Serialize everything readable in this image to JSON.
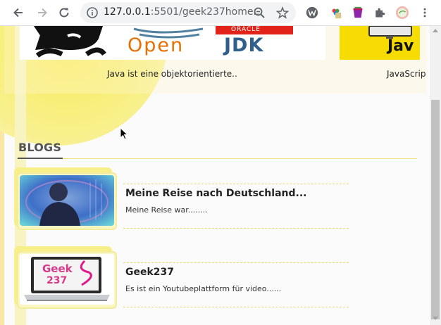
{
  "browser": {
    "url_host": "127.0.0.1",
    "url_rest": ":5501/geek237home...",
    "icons": {
      "back": "arrow-left-icon",
      "forward": "arrow-right-icon",
      "reload": "reload-icon",
      "site_info": "info-icon",
      "zoom": "zoom-icon",
      "bookmark": "star-icon",
      "extensions": "puzzle-icon",
      "menu": "kebab-menu-icon"
    }
  },
  "cards": [
    {
      "caption": "Java ist eine objektorientierte..",
      "image": "java-openjdk-logo",
      "image_text_1": "ORACLE",
      "image_text_2": "Open",
      "image_text_3": "JDK"
    },
    {
      "caption": "JavaScrip",
      "image": "javascript-logo",
      "image_text_1": "Jav"
    }
  ],
  "blogs": {
    "heading": "BLOGS",
    "items": [
      {
        "title": "Meine Reise nach Deutschland...",
        "text": "Meine Reise war........",
        "image": "person-photo"
      },
      {
        "title": "Geek237",
        "text": "Es ist ein Youtubeplattform für video......",
        "image": "geek237-laptop",
        "image_text_1": "Geek",
        "image_text_2": "237"
      }
    ]
  },
  "colors": {
    "accent_yellow": "#f6ec5a",
    "js_yellow": "#f7dc04",
    "heading_gray": "#555555",
    "scrollbar_thumb": "#c1c1c1"
  }
}
